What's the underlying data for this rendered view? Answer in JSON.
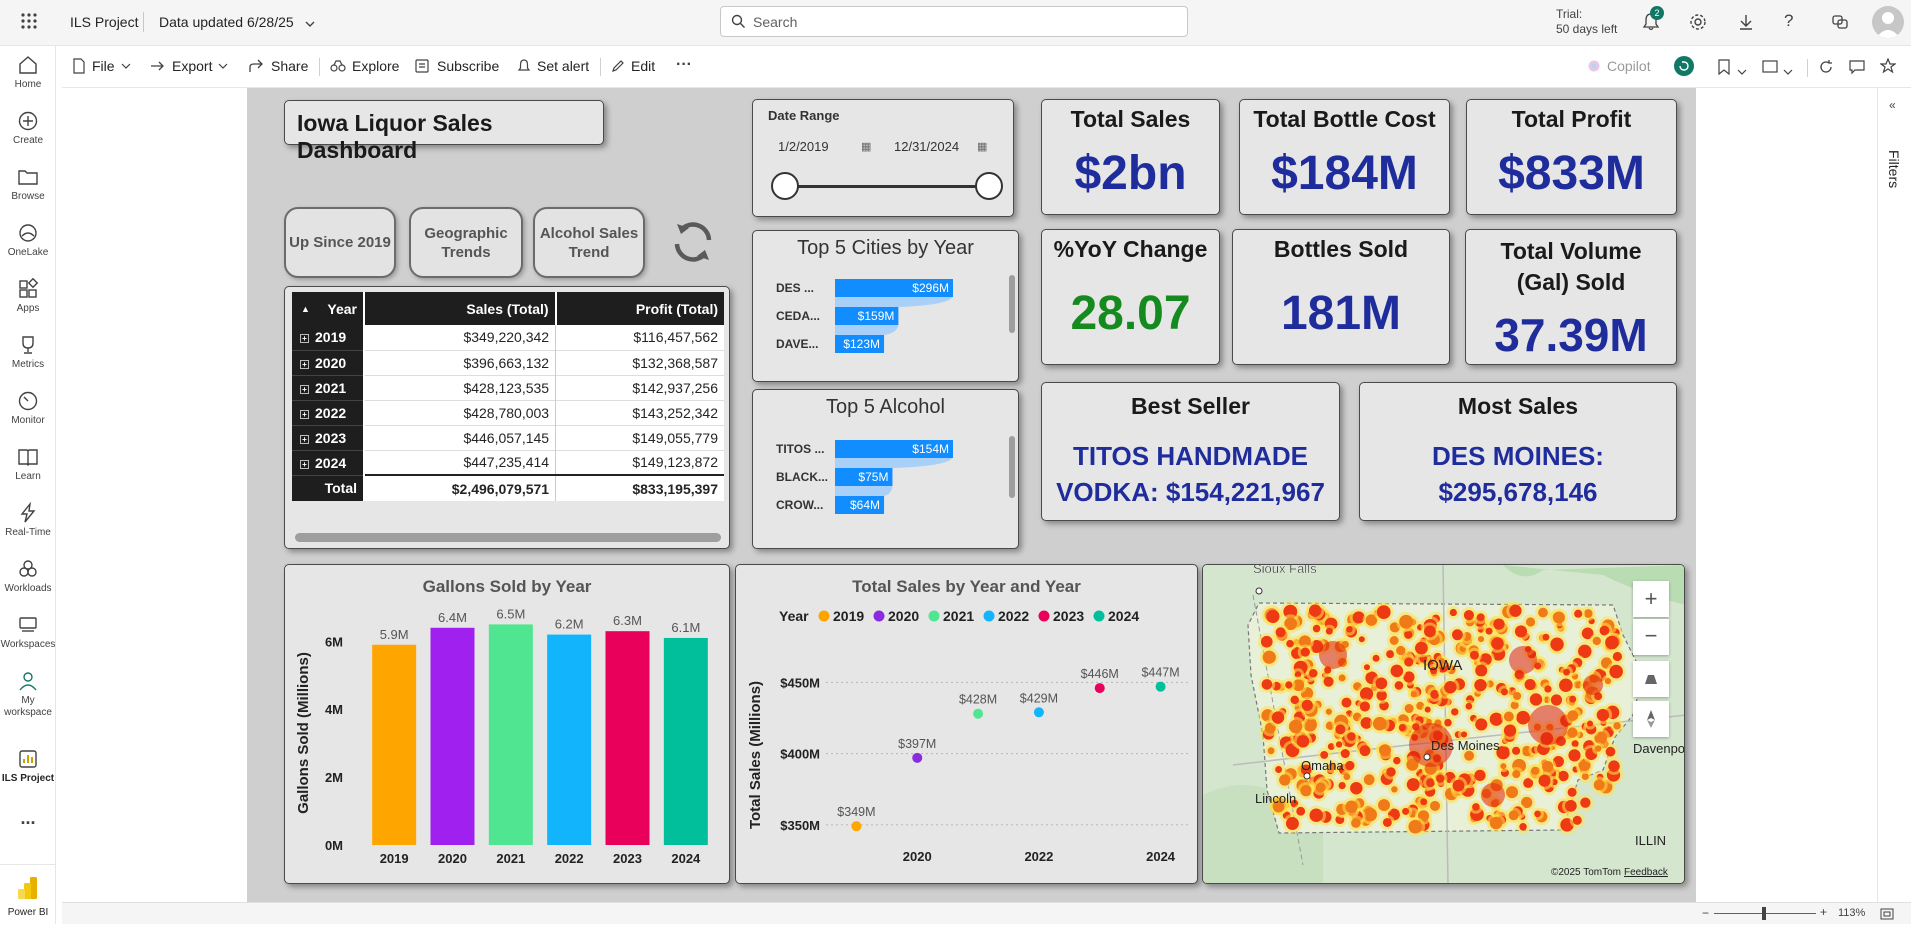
{
  "app": {
    "workspace": "ILS Project",
    "updated": "Data updated 6/28/25",
    "search_placeholder": "Search",
    "trial_line1": "Trial:",
    "trial_line2": "50 days left",
    "notif_count": "2"
  },
  "nav": [
    {
      "label": "Home",
      "icon": "home-icon"
    },
    {
      "label": "Create",
      "icon": "plus-circle-icon"
    },
    {
      "label": "Browse",
      "icon": "folder-icon"
    },
    {
      "label": "OneLake",
      "icon": "onelake-icon"
    },
    {
      "label": "Apps",
      "icon": "apps-icon"
    },
    {
      "label": "Metrics",
      "icon": "trophy-icon"
    },
    {
      "label": "Monitor",
      "icon": "monitor-icon"
    },
    {
      "label": "Learn",
      "icon": "book-icon"
    },
    {
      "label": "Real-Time",
      "icon": "lightning-icon"
    },
    {
      "label": "Workloads",
      "icon": "workloads-icon"
    },
    {
      "label": "Workspaces",
      "icon": "workspaces-icon"
    },
    {
      "label": "My workspace",
      "icon": "person-icon"
    },
    {
      "label": "ILS Project",
      "icon": "report-icon"
    },
    {
      "label": "...",
      "icon": "more-icon"
    },
    {
      "label": "Power BI",
      "icon": "powerbi-icon"
    }
  ],
  "toolbar": {
    "file": "File",
    "export": "Export",
    "share": "Share",
    "explore": "Explore",
    "subscribe": "Subscribe",
    "set_alert": "Set alert",
    "edit": "Edit",
    "more": "···",
    "copilot": "Copilot"
  },
  "filters_label": "Filters",
  "dashboard": {
    "title": "Iowa Liquor Sales Dashboard",
    "buttons": [
      "Up Since 2019",
      "Geographic Trends",
      "Alcohol Sales Trend"
    ],
    "date_range": {
      "label": "Date Range",
      "start": "1/2/2019",
      "end": "12/31/2024"
    },
    "kpis": {
      "total_sales": {
        "title": "Total Sales",
        "value": "$2bn"
      },
      "bottle_cost": {
        "title": "Total Bottle Cost",
        "value": "$184M"
      },
      "profit": {
        "title": "Total Profit",
        "value": "$833M"
      },
      "yoy": {
        "title": "%YoY Change",
        "value": "28.07"
      },
      "bottles": {
        "title": "Bottles Sold",
        "value": "181M"
      },
      "volume": {
        "title": "Total Volume (Gal) Sold",
        "value": "37.39M"
      },
      "best_seller": {
        "title": "Best Seller",
        "line1": "TITOS HANDMADE",
        "line2": "VODKA: $154,221,967"
      },
      "most_sales": {
        "title": "Most Sales",
        "line1": "DES MOINES:",
        "line2": "$295,678,146"
      }
    },
    "matrix": {
      "headers": [
        "Year",
        "Sales (Total)",
        "Profit (Total)"
      ],
      "rows": [
        [
          "2019",
          "$349,220,342",
          "$116,457,562"
        ],
        [
          "2020",
          "$396,663,132",
          "$132,368,587"
        ],
        [
          "2021",
          "$428,123,535",
          "$142,937,256"
        ],
        [
          "2022",
          "$428,780,003",
          "$143,252,342"
        ],
        [
          "2023",
          "$446,057,145",
          "$149,055,779"
        ],
        [
          "2024",
          "$447,235,414",
          "$149,123,872"
        ]
      ],
      "total": [
        "Total",
        "$2,496,079,571",
        "$833,195,397"
      ]
    },
    "map": {
      "labels": [
        "Sioux Falls",
        "IOWA",
        "Des Moines",
        "Omaha",
        "Lincoln",
        "Davenport",
        "ILLIN"
      ],
      "copyright": "©2025 TomTom",
      "feedback": "Feedback"
    }
  },
  "status": {
    "zoom": "113%"
  },
  "chart_data": [
    {
      "type": "bar",
      "title": "Top 5 Cities by Year",
      "orientation": "horizontal",
      "categories": [
        "DES ...",
        "CEDA...",
        "DAVE..."
      ],
      "values": [
        296,
        159,
        123
      ],
      "labels": [
        "$296M",
        "$159M",
        "$123M"
      ],
      "color": "#118dff"
    },
    {
      "type": "bar",
      "title": "Top 5 Alcohol",
      "orientation": "horizontal",
      "categories": [
        "TITOS ...",
        "BLACK...",
        "CROW..."
      ],
      "values": [
        154,
        75,
        64
      ],
      "labels": [
        "$154M",
        "$75M",
        "$64M"
      ],
      "color": "#118dff"
    },
    {
      "type": "bar",
      "title": "Gallons Sold by Year",
      "ylabel": "Gallons Sold (Millions)",
      "categories": [
        "2019",
        "2020",
        "2021",
        "2022",
        "2023",
        "2024"
      ],
      "values": [
        5.9,
        6.4,
        6.5,
        6.2,
        6.3,
        6.1
      ],
      "labels": [
        "5.9M",
        "6.4M",
        "6.5M",
        "6.2M",
        "6.3M",
        "6.1M"
      ],
      "yticks": [
        "0M",
        "2M",
        "4M",
        "6M"
      ],
      "ylim": [
        0,
        6.6
      ],
      "colors": [
        "#ffa500",
        "#a020f0",
        "#50e591",
        "#12b5fc",
        "#e8005a",
        "#00bf9a"
      ]
    },
    {
      "type": "scatter",
      "title": "Total Sales by Year and Year",
      "ylabel": "Total Sales (Millions)",
      "legend_title": "Year",
      "x": [
        2019,
        2020,
        2021,
        2022,
        2023,
        2024
      ],
      "y": [
        349,
        397,
        428,
        429,
        446,
        447
      ],
      "labels": [
        "$349M",
        "$397M",
        "$428M",
        "$429M",
        "$446M",
        "$447M"
      ],
      "series": [
        "2019",
        "2020",
        "2021",
        "2022",
        "2023",
        "2024"
      ],
      "xticks": [
        "2020",
        "2022",
        "2024"
      ],
      "yticks": [
        "$350M",
        "$400M",
        "$450M"
      ],
      "xlim": [
        2018.5,
        2024.5
      ],
      "ylim": [
        340,
        458
      ],
      "colors": [
        "#ffa500",
        "#8a2be2",
        "#50e591",
        "#12b5fc",
        "#e8005a",
        "#00bf9a"
      ]
    }
  ]
}
